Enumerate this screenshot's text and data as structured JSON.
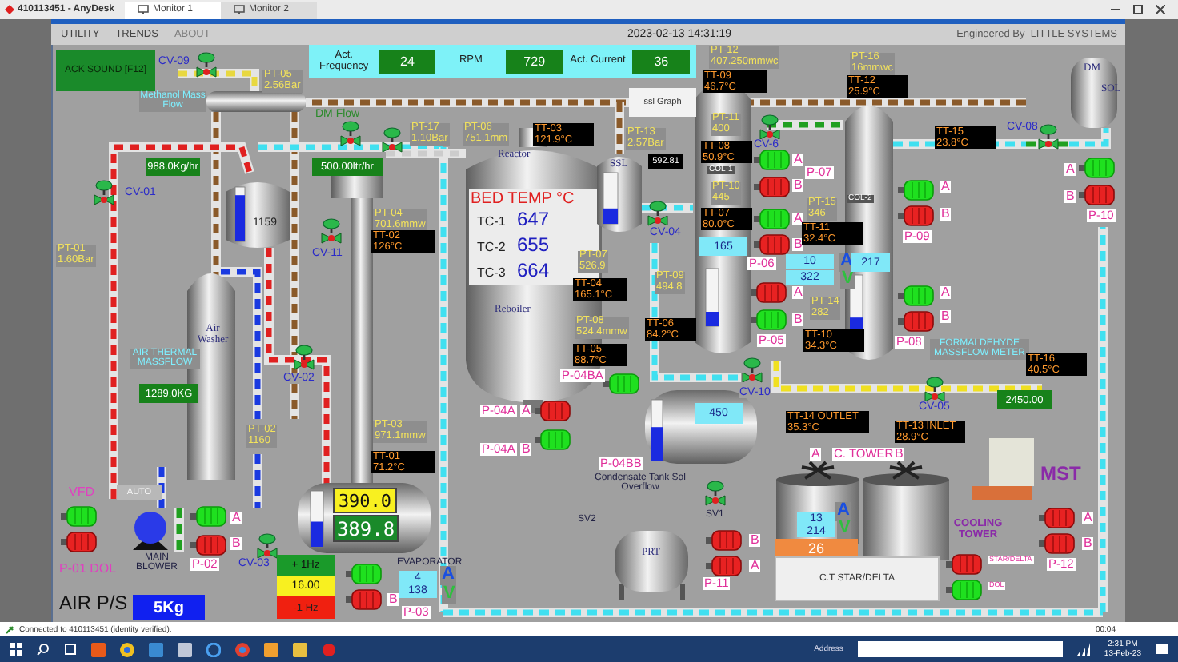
{
  "app": {
    "title": "410113451 - AnyDesk",
    "tabs": [
      {
        "label": "Monitor 1",
        "selected": true
      },
      {
        "label": "Monitor 2",
        "selected": false
      }
    ]
  },
  "menu": [
    {
      "label": "UTILITY",
      "disabled": false
    },
    {
      "label": "TRENDS",
      "disabled": false
    },
    {
      "label": "ABOUT",
      "disabled": true
    }
  ],
  "timestamp": "2023-02-13 14:31:19",
  "credit": "Engineered By  LITTLE SYSTEMS",
  "stats": [
    {
      "label": "Act. Frequency",
      "value": "24"
    },
    {
      "label": "RPM",
      "value": "729"
    },
    {
      "label": "Act. Current",
      "value": "36"
    }
  ],
  "buttons": [
    {
      "kind": "alarm",
      "label": "ACK SOUND [F12]"
    },
    {
      "kind": "plain",
      "label": "ssl Graph"
    },
    {
      "kind": "mode",
      "label": "AUTO"
    },
    {
      "kind": "increase",
      "label": "+ 1Hz"
    },
    {
      "kind": "decrease",
      "label": "-1 Hz"
    },
    {
      "kind": "panel",
      "label": "C.T STAR/DELTA"
    }
  ],
  "tags": [
    {
      "kind": "valve",
      "text": "CV-09"
    },
    {
      "kind": "pressure",
      "text": "PT-05",
      "value": "2.56Bar"
    },
    {
      "kind": "flow",
      "text": "Methanol Mass Flow"
    },
    {
      "kind": "meter",
      "text": "DM Flow"
    },
    {
      "kind": "pressure",
      "text": "PT-17",
      "value": "1.10Bar"
    },
    {
      "kind": "pressure",
      "text": "PT-06",
      "value": "751.1mm"
    },
    {
      "kind": "pressure",
      "text": "PT-13",
      "value": "2.57Bar"
    },
    {
      "kind": "valve",
      "text": "CV-01"
    },
    {
      "kind": "pressure",
      "text": "PT-04",
      "value": "701.6mmw"
    },
    {
      "kind": "pressure",
      "text": "PT-01",
      "value": "1.60Bar"
    },
    {
      "kind": "valve",
      "text": "CV-11"
    },
    {
      "kind": "flow",
      "text": "AIR THERMAL MASSFLOW"
    },
    {
      "kind": "valve",
      "text": "CV-02"
    },
    {
      "kind": "pressure",
      "text": "PT-02",
      "value": "1160"
    },
    {
      "kind": "pressure",
      "text": "PT-03",
      "value": "971.1mmw"
    },
    {
      "kind": "drive",
      "text": "VFD"
    },
    {
      "kind": "drive",
      "text": "P-01 DOL"
    },
    {
      "kind": "note",
      "text": "MAIN BLOWER"
    },
    {
      "kind": "pump",
      "text": "P-02"
    },
    {
      "kind": "letter",
      "text": "A"
    },
    {
      "kind": "letter",
      "text": "B"
    },
    {
      "kind": "valve",
      "text": "CV-03"
    },
    {
      "kind": "note",
      "text": "EVAPORATOR"
    },
    {
      "kind": "indicator",
      "text": "A",
      "color": "#1a4fe0"
    },
    {
      "kind": "indicator",
      "text": "V",
      "color": "#2fbf3f"
    },
    {
      "kind": "letter",
      "text": "B"
    },
    {
      "kind": "pump",
      "text": "P-03"
    },
    {
      "kind": "pressure",
      "text": "PT-12",
      "value": "407.250mmwc"
    },
    {
      "kind": "pressure",
      "text": "PT-16",
      "value": "16mmwc"
    },
    {
      "kind": "pressure",
      "text": "PT-11",
      "value": "400"
    },
    {
      "kind": "valve",
      "text": "CV-6"
    },
    {
      "kind": "letter",
      "text": "A"
    },
    {
      "kind": "letter",
      "text": "B"
    },
    {
      "kind": "pump",
      "text": "P-07"
    },
    {
      "kind": "pressure",
      "text": "PT-10",
      "value": "445"
    },
    {
      "kind": "pressure",
      "text": "PT-15",
      "value": "346"
    },
    {
      "kind": "valve",
      "text": "CV-04"
    },
    {
      "kind": "letter",
      "text": "A"
    },
    {
      "kind": "letter",
      "text": "B"
    },
    {
      "kind": "pressure",
      "text": "PT-07",
      "value": "526.9"
    },
    {
      "kind": "pump",
      "text": "P-06"
    },
    {
      "kind": "pressure",
      "text": "PT-09",
      "value": "494.8"
    },
    {
      "kind": "letter",
      "text": "A"
    },
    {
      "kind": "letter",
      "text": "B"
    },
    {
      "kind": "pump",
      "text": "P-05"
    },
    {
      "kind": "pressure",
      "text": "PT-14",
      "value": "282"
    },
    {
      "kind": "pressure",
      "text": "PT-08",
      "value": "524.4mmw"
    },
    {
      "kind": "pump",
      "text": "P-04BA"
    },
    {
      "kind": "pump",
      "text": "P-04A"
    },
    {
      "kind": "letter",
      "text": "A"
    },
    {
      "kind": "pump",
      "text": "P-04A"
    },
    {
      "kind": "letter",
      "text": "B"
    },
    {
      "kind": "pump",
      "text": "P-04BB"
    },
    {
      "kind": "note",
      "text": "Condensate Tank Sol Overflow"
    },
    {
      "kind": "valve",
      "text": "CV-10"
    },
    {
      "kind": "letter",
      "text": "A"
    },
    {
      "kind": "letter",
      "text": "B"
    },
    {
      "kind": "pump",
      "text": "P-09"
    },
    {
      "kind": "letter",
      "text": "A"
    },
    {
      "kind": "letter",
      "text": "B"
    },
    {
      "kind": "pump",
      "text": "P-08"
    },
    {
      "kind": "valve",
      "text": "CV-08"
    },
    {
      "kind": "letter",
      "text": "A"
    },
    {
      "kind": "letter",
      "text": "B"
    },
    {
      "kind": "pump",
      "text": "P-10"
    },
    {
      "kind": "flow",
      "text": "FORMALDEHYDE MASSFLOW METER"
    },
    {
      "kind": "valve",
      "text": "CV-05"
    },
    {
      "kind": "indicator",
      "text": "A",
      "color": "#1a4fe0"
    },
    {
      "kind": "indicator",
      "text": "V",
      "color": "#2fbf3f"
    },
    {
      "kind": "letter",
      "text": "A"
    },
    {
      "kind": "pump",
      "text": "C. TOWER"
    },
    {
      "kind": "letter",
      "text": "B"
    },
    {
      "kind": "indicator",
      "text": "A",
      "color": "#1a4fe0"
    },
    {
      "kind": "indicator",
      "text": "V",
      "color": "#2fbf3f"
    },
    {
      "kind": "title",
      "text": "MST"
    },
    {
      "kind": "group",
      "text": "COOLING TOWER"
    },
    {
      "kind": "tiny",
      "text": "STAR/DELTA"
    },
    {
      "kind": "tiny",
      "text": "DOL"
    },
    {
      "kind": "letter",
      "text": "A"
    },
    {
      "kind": "letter",
      "text": "B"
    },
    {
      "kind": "pump",
      "text": "P-12"
    },
    {
      "kind": "note",
      "text": "SV2"
    },
    {
      "kind": "note",
      "text": "SV1"
    },
    {
      "kind": "letter",
      "text": "B"
    },
    {
      "kind": "letter",
      "text": "A"
    },
    {
      "kind": "pump",
      "text": "P-11"
    },
    {
      "kind": "vessel",
      "text": "PRT"
    },
    {
      "kind": "vessel",
      "text": "Reactor"
    },
    {
      "kind": "heading",
      "text": "BED TEMP °C"
    },
    {
      "kind": "sensor",
      "text": "TC-1"
    },
    {
      "kind": "reading",
      "text": "647"
    },
    {
      "kind": "sensor",
      "text": "TC-2"
    },
    {
      "kind": "reading",
      "text": "655"
    },
    {
      "kind": "sensor",
      "text": "TC-3"
    },
    {
      "kind": "reading",
      "text": "664"
    },
    {
      "kind": "vessel",
      "text": "Reboiler"
    },
    {
      "kind": "small",
      "text": "COL-1"
    },
    {
      "kind": "small",
      "text": "COL-2"
    },
    {
      "kind": "vessel",
      "text": "DM"
    },
    {
      "kind": "vessel",
      "text": "SOL"
    },
    {
      "kind": "vessel",
      "text": "SSL"
    },
    {
      "kind": "vessel",
      "text": "Air Washer"
    },
    {
      "kind": "level",
      "text": "1159"
    },
    {
      "kind": "label",
      "text": "AIR P/S"
    }
  ],
  "readouts": [
    {
      "tag": "TT-03",
      "value": "121.9°C"
    },
    {
      "tag": "TT-09",
      "value": "46.7°C"
    },
    {
      "tag": "TT-12",
      "value": "25.9°C"
    },
    {
      "tag": "TT-15",
      "value": "23.8°C"
    },
    {
      "tag": "TT-08",
      "value": "50.9°C"
    },
    {
      "tag": "TT-07",
      "value": "80.0°C"
    },
    {
      "tag": "TT-02",
      "value": "126°C"
    },
    {
      "tag": "TT-11",
      "value": "32.4°C"
    },
    {
      "tag": "TT-04",
      "value": "165.1°C"
    },
    {
      "tag": "TT-06",
      "value": "84.2°C"
    },
    {
      "tag": "TT-10",
      "value": "34.3°C"
    },
    {
      "tag": "TT-05",
      "value": "88.7°C"
    },
    {
      "tag": "TT-16",
      "value": "40.5°C"
    },
    {
      "tag": "TT-14 OUTLET",
      "value": "35.3°C"
    },
    {
      "tag": "TT-13 INLET",
      "value": "28.9°C"
    },
    {
      "tag": "TT-01",
      "value": "71.2°C"
    }
  ],
  "displays": [
    {
      "kind": "flow",
      "text": "988.0Kg/hr"
    },
    {
      "kind": "flow",
      "text": "500.00ltr/hr"
    },
    {
      "kind": "dark",
      "text": "592.81"
    },
    {
      "kind": "level",
      "text": "165"
    },
    {
      "kind": "level",
      "text": "10"
    },
    {
      "kind": "level",
      "text": "322"
    },
    {
      "kind": "level",
      "text": "217"
    },
    {
      "kind": "flow",
      "text": "1289.0KG"
    },
    {
      "kind": "level",
      "text": "450"
    },
    {
      "kind": "flow",
      "text": "2450.00"
    },
    {
      "kind": "setpoint",
      "text": "390.0"
    },
    {
      "kind": "actual",
      "text": "389.8"
    },
    {
      "kind": "level",
      "text": "4"
    },
    {
      "kind": "level",
      "text": "138"
    },
    {
      "kind": "freq",
      "text": "16.00"
    },
    {
      "kind": "level",
      "text": "13"
    },
    {
      "kind": "level",
      "text": "214"
    },
    {
      "kind": "count",
      "text": "26"
    },
    {
      "kind": "pressure",
      "text": "5Kg"
    }
  ],
  "pumps": [
    {
      "running": true
    },
    {
      "running": false
    },
    {
      "running": true
    },
    {
      "running": false
    },
    {
      "running": false
    },
    {
      "running": true
    },
    {
      "running": true
    },
    {
      "running": false
    },
    {
      "running": true
    },
    {
      "running": false
    },
    {
      "running": true
    },
    {
      "running": false
    },
    {
      "running": true
    },
    {
      "running": false
    },
    {
      "running": true
    },
    {
      "running": true
    },
    {
      "running": false
    },
    {
      "running": true
    },
    {
      "running": false
    },
    {
      "running": true
    },
    {
      "running": false
    },
    {
      "running": false
    },
    {
      "running": false
    },
    {
      "running": false
    },
    {
      "running": false
    },
    {
      "running": false
    },
    {
      "running": true
    }
  ],
  "gauges": [
    {
      "level": 0.3
    },
    {
      "level": 0.85
    },
    {
      "level": 0.25
    },
    {
      "level": 0.3
    },
    {
      "level": 0.55
    },
    {
      "level": 0.45
    }
  ],
  "status": {
    "message": "Connected to 410113451 (identity verified).",
    "timer": "00:04"
  },
  "taskbar": {
    "address_label": "Address",
    "time": "2:31 PM",
    "date": "13-Feb-23"
  }
}
